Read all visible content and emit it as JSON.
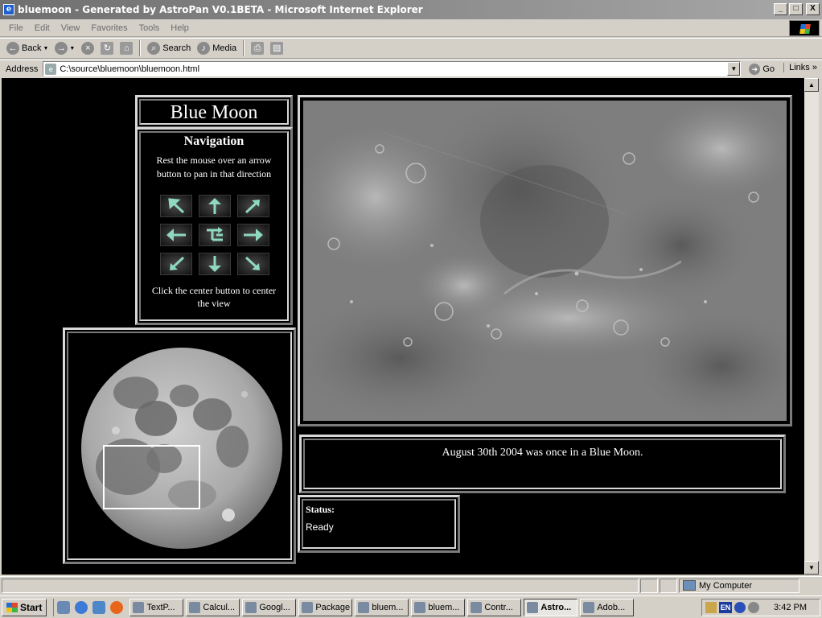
{
  "window": {
    "title": "bluemoon - Generated by AstroPan V0.1BETA - Microsoft Internet Explorer",
    "app_icon": "e",
    "minimize": "_",
    "maximize": "□",
    "close": "X"
  },
  "menu": [
    "File",
    "Edit",
    "View",
    "Favorites",
    "Tools",
    "Help"
  ],
  "toolbar": {
    "back": "Back",
    "search": "Search",
    "media": "Media"
  },
  "address": {
    "label": "Address",
    "value": "C:\\source\\bluemoon\\bluemoon.html",
    "go": "Go",
    "links": "Links"
  },
  "page": {
    "title": "Blue Moon",
    "nav_heading": "Navigation",
    "nav_help": "Rest the mouse over an arrow button to pan in that direction",
    "nav_center_help": "Click the center button to center the view",
    "caption": "August 30th 2004 was once in a Blue Moon.",
    "status_label": "Status:",
    "status_value": "Ready",
    "arrow_color": "#8fd9c0"
  },
  "statusbar": {
    "zone": "My Computer"
  },
  "taskbar": {
    "start": "Start",
    "tasks": [
      "TextP...",
      "Calcul...",
      "Googl...",
      "Package",
      "bluem...",
      "bluem...",
      "Contr...",
      "Astro...",
      "Adob..."
    ],
    "active_task_index": 7,
    "language": "EN",
    "clock": "3:42 PM"
  }
}
